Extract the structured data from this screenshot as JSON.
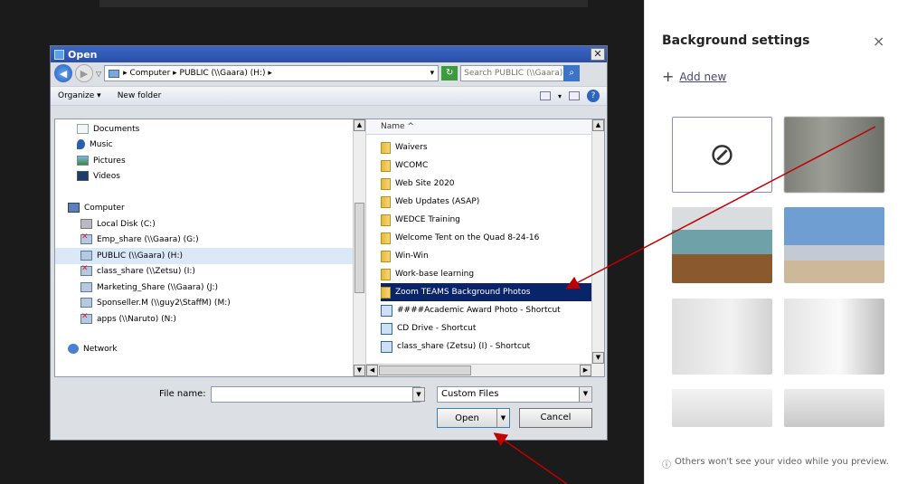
{
  "open_dialog": {
    "title": "Open",
    "close": "✕",
    "address_path": "▸ Computer ▸ PUBLIC (\\\\Gaara) (H:) ▸",
    "search_placeholder": "Search PUBLIC (\\\\Gaara) (H:)",
    "toolbar": {
      "organize": "Organize ▾",
      "new_folder": "New folder"
    },
    "nav_items": [
      {
        "label": "Documents",
        "icon": "documents-icon"
      },
      {
        "label": "Music",
        "icon": "music-icon"
      },
      {
        "label": "Pictures",
        "icon": "pictures-icon"
      },
      {
        "label": "Videos",
        "icon": "videos-icon"
      },
      {
        "label": "Computer",
        "icon": "computer-icon"
      },
      {
        "label": "Local Disk (C:)",
        "icon": "disk-icon"
      },
      {
        "label": "Emp_share (\\\\Gaara) (G:)",
        "icon": "disconnected-drive-icon"
      },
      {
        "label": "PUBLIC (\\\\Gaara) (H:)",
        "icon": "network-drive-icon"
      },
      {
        "label": "class_share (\\\\Zetsu) (I:)",
        "icon": "disconnected-drive-icon"
      },
      {
        "label": "Marketing_Share (\\\\Gaara) (J:)",
        "icon": "network-drive-icon"
      },
      {
        "label": "Sponseller.M (\\\\guy2\\StaffM) (M:)",
        "icon": "network-drive-icon"
      },
      {
        "label": "apps (\\\\Naruto) (N:)",
        "icon": "disconnected-drive-icon"
      },
      {
        "label": "Network",
        "icon": "network-icon"
      }
    ],
    "column_header": "Name  ^",
    "files": [
      {
        "label": "Waivers",
        "type": "folder"
      },
      {
        "label": "WCOMC",
        "type": "folder"
      },
      {
        "label": "Web Site 2020",
        "type": "folder"
      },
      {
        "label": "Web Updates (ASAP)",
        "type": "folder"
      },
      {
        "label": "WEDCE Training",
        "type": "folder"
      },
      {
        "label": "Welcome Tent on the Quad 8-24-16",
        "type": "folder"
      },
      {
        "label": "Win-Win",
        "type": "folder"
      },
      {
        "label": "Work-base learning",
        "type": "folder"
      },
      {
        "label": "Zoom TEAMS  Background Photos",
        "type": "folder",
        "selected": true
      },
      {
        "label": "####Academic Award Photo - Shortcut",
        "type": "shortcut"
      },
      {
        "label": "CD Drive - Shortcut",
        "type": "shortcut"
      },
      {
        "label": "class_share (Zetsu) (I) - Shortcut",
        "type": "shortcut"
      }
    ],
    "file_name_label": "File name:",
    "file_name_value": "",
    "file_type": "Custom Files",
    "open_label": "Open",
    "cancel_label": "Cancel"
  },
  "background_settings": {
    "title": "Background settings",
    "close": "×",
    "add_new_icon": "+",
    "add_new": "Add new",
    "none_icon": "⊘",
    "tiles": [
      "none",
      "blur",
      "office",
      "beach",
      "room1",
      "room2",
      "room3",
      "room4"
    ],
    "note_icon": "ⓘ",
    "note": "Others won't see your video while you preview."
  },
  "colors": {
    "selection": "#0a246a",
    "accent": "#464775",
    "annotation": "#c00000"
  }
}
